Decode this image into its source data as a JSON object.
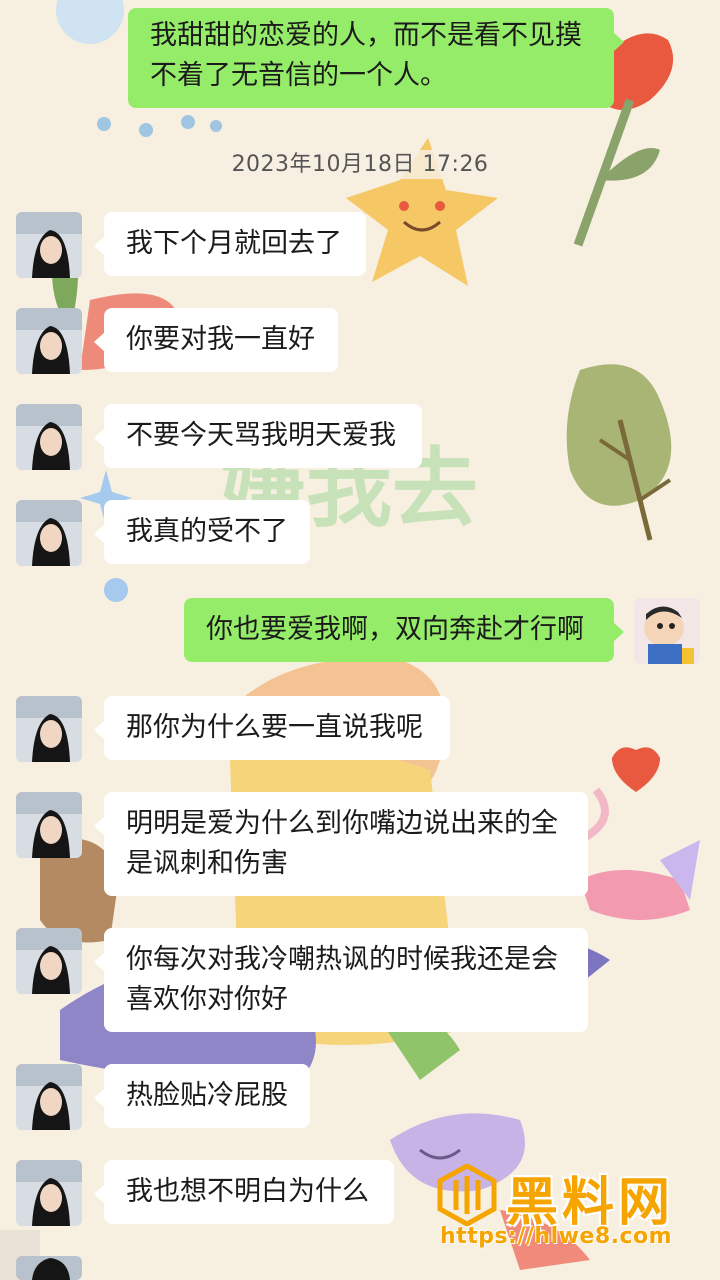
{
  "timestamp": "2023年10月18日 17:26",
  "messages": [
    {
      "side": "right",
      "text": "我甜甜的恋爱的人，而不是看不见摸\n不着了无音信的一个人。"
    },
    {
      "side": "left",
      "text": "我下个月就回去了"
    },
    {
      "side": "left",
      "text": "你要对我一直好"
    },
    {
      "side": "left",
      "text": "不要今天骂我明天爱我"
    },
    {
      "side": "left",
      "text": "我真的受不了"
    },
    {
      "side": "right",
      "text": "你也要爱我啊，双向奔赴才行啊"
    },
    {
      "side": "left",
      "text": "那你为什么要一直说我呢"
    },
    {
      "side": "left",
      "text": "明明是爱为什么到你嘴边说出来的全\n是讽刺和伤害"
    },
    {
      "side": "left",
      "text": "你每次对我冷嘲热讽的时候我还是会\n喜欢你对你好"
    },
    {
      "side": "left",
      "text": "热脸贴冷屁股"
    },
    {
      "side": "left",
      "text": "我也想不明白为什么"
    }
  ],
  "background_text": "嫌我去",
  "watermark": {
    "brand": "黑料网",
    "url": "https://hlwe8.com"
  },
  "colors": {
    "self_bubble": "#95ec69",
    "other_bubble": "#ffffff",
    "background": "#f7efe0",
    "watermark": "#f5a400"
  }
}
